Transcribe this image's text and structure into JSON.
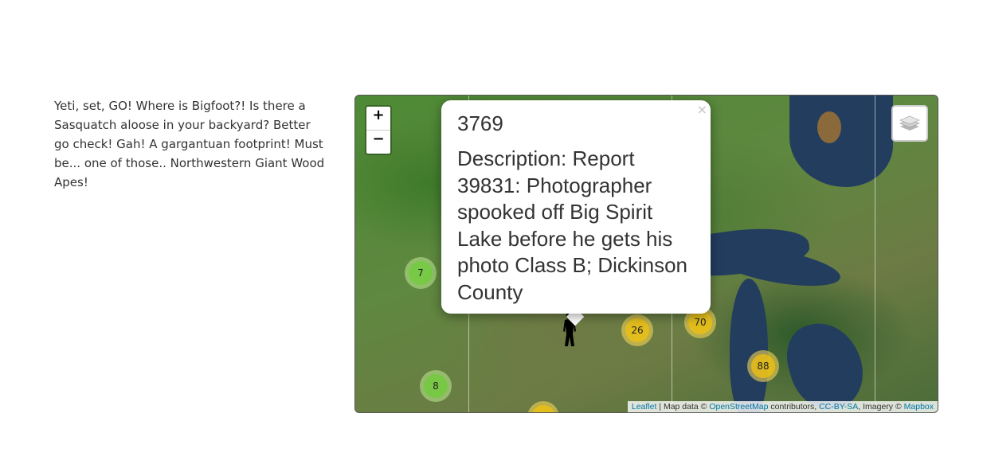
{
  "intro": {
    "text": "Yeti, set, GO! Where is Bigfoot?! Is there a Sasquatch aloose in your backyard? Better go check! Gah! A gargantuan footprint! Must be... one of those.. Northwestern Giant Wood Apes!"
  },
  "map": {
    "zoom_in_label": "+",
    "zoom_out_label": "−",
    "layers_icon": "layers-icon",
    "clusters": [
      {
        "count": "7",
        "size": "small"
      },
      {
        "count": "8",
        "size": "small"
      },
      {
        "count": "26",
        "size": "medium"
      },
      {
        "count": "70",
        "size": "medium"
      },
      {
        "count": "88",
        "size": "medium"
      },
      {
        "count": "",
        "size": "medium"
      }
    ],
    "popup": {
      "title": "3769",
      "description": "Description: Report 39831: Photographer spooked off Big Spirit Lake before he gets his photo Class B; Dickinson County",
      "close_label": "×"
    },
    "marker_icon": "bigfoot-icon",
    "attribution": {
      "leaflet": "Leaflet",
      "sep": " | Map data © ",
      "osm": "OpenStreetMap",
      "contributors": " contributors, ",
      "license": "CC-BY-SA",
      "imagery": ", Imagery © ",
      "mapbox": "Mapbox"
    }
  },
  "colors": {
    "link": "#0078a8",
    "cluster_small": "#6ecc39",
    "cluster_medium": "#f0c20c"
  }
}
